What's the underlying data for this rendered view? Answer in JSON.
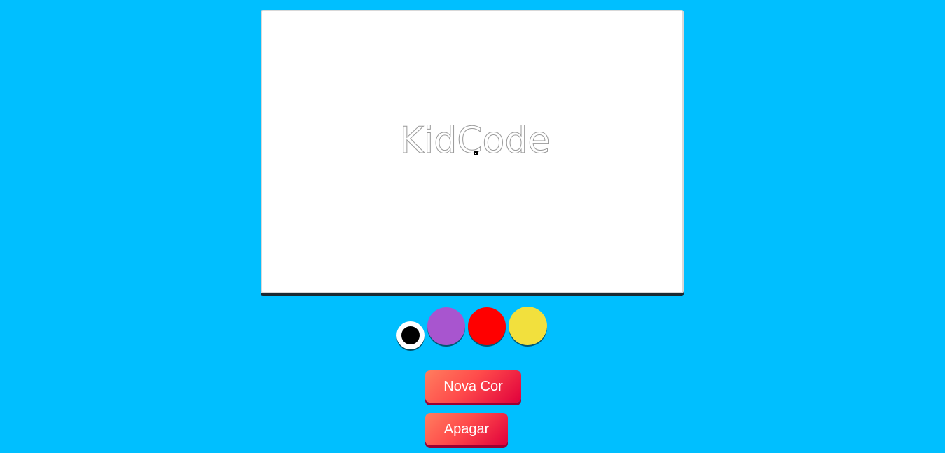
{
  "canvas": {
    "watermark_text": "KidCode"
  },
  "palette": {
    "swatches": [
      {
        "name": "black",
        "color": "#000000",
        "selected": true
      },
      {
        "name": "purple",
        "color": "#a855cf",
        "selected": false
      },
      {
        "name": "red",
        "color": "#ff0000",
        "selected": false
      },
      {
        "name": "yellow",
        "color": "#f2e03d",
        "selected": false
      }
    ]
  },
  "buttons": {
    "new_color_label": "Nova Cor",
    "erase_label": "Apagar"
  }
}
